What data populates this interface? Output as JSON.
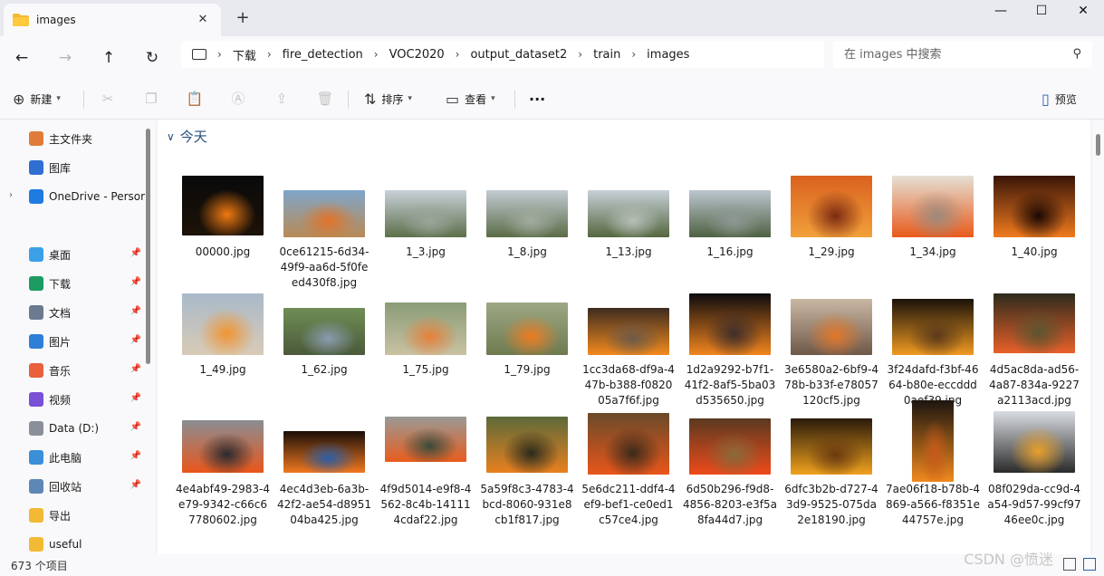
{
  "tab": {
    "title": "images",
    "close": "✕",
    "new_tab": "+"
  },
  "window": {
    "minimize": "—",
    "maximize": "☐",
    "close": "✕"
  },
  "nav": {
    "back": "←",
    "forward": "→",
    "up": "↑",
    "refresh": "↻"
  },
  "breadcrumb": [
    "下载",
    "fire_detection",
    "VOC2020",
    "output_dataset2",
    "train",
    "images"
  ],
  "search": {
    "placeholder": "在 images 中搜索"
  },
  "commands": {
    "new": "新建",
    "sort": "排序",
    "view": "查看",
    "more": "···",
    "preview": "预览"
  },
  "sidebar": {
    "items": [
      {
        "label": "主文件夹",
        "icon": "home-icon",
        "color": "#e07b39"
      },
      {
        "label": "图库",
        "icon": "gallery-icon",
        "color": "#2f6fd1"
      },
      {
        "label": "OneDrive - Persor",
        "icon": "onedrive-icon",
        "color": "#1e7be0"
      },
      {
        "label": "桌面",
        "icon": "desktop-icon",
        "color": "#3aa0e8",
        "pinned": true
      },
      {
        "label": "下载",
        "icon": "download-icon",
        "color": "#1b9b62",
        "pinned": true
      },
      {
        "label": "文档",
        "icon": "document-icon",
        "color": "#6b7a8f",
        "pinned": true
      },
      {
        "label": "图片",
        "icon": "pictures-icon",
        "color": "#2f7fd8",
        "pinned": true
      },
      {
        "label": "音乐",
        "icon": "music-icon",
        "color": "#e8603c",
        "pinned": true
      },
      {
        "label": "视频",
        "icon": "video-icon",
        "color": "#7b4fd6",
        "pinned": true
      },
      {
        "label": "Data (D:)",
        "icon": "drive-icon",
        "color": "#8a8f99",
        "pinned": true
      },
      {
        "label": "此电脑",
        "icon": "this-pc-icon",
        "color": "#3a8fd8",
        "pinned": true
      },
      {
        "label": "回收站",
        "icon": "recycle-bin-icon",
        "color": "#5d88b5",
        "pinned": true
      },
      {
        "label": "导出",
        "icon": "folder-icon",
        "color": "#f2b935"
      },
      {
        "label": "useful",
        "icon": "folder-icon",
        "color": "#f2b935"
      }
    ],
    "pin_glyph": "📌"
  },
  "group": {
    "label": "今天",
    "chevron": "∨"
  },
  "files": [
    {
      "name": "00000.jpg",
      "colors": [
        "#0a0a0a",
        "#1c1208",
        "#f07a12"
      ]
    },
    {
      "name": "0ce61215-6d34-49f9-aa6d-5f0feed430f8.jpg",
      "colors": [
        "#7fa6c9",
        "#b88a55",
        "#e2732a"
      ]
    },
    {
      "name": "1_3.jpg",
      "colors": [
        "#c9d1d9",
        "#5d6f4a",
        "#9aa59b"
      ]
    },
    {
      "name": "1_8.jpg",
      "colors": [
        "#c3ccd4",
        "#5b6c47",
        "#a3ab9f"
      ]
    },
    {
      "name": "1_13.jpg",
      "colors": [
        "#c8d0d8",
        "#55673f",
        "#b7bfb8"
      ]
    },
    {
      "name": "1_16.jpg",
      "colors": [
        "#bcc6cf",
        "#4e6142",
        "#8d9893"
      ]
    },
    {
      "name": "1_29.jpg",
      "colors": [
        "#d9621e",
        "#f2a03a",
        "#7b2a12"
      ]
    },
    {
      "name": "1_34.jpg",
      "colors": [
        "#e6e0d5",
        "#e85a1a",
        "#9c8a7c"
      ]
    },
    {
      "name": "1_40.jpg",
      "colors": [
        "#3a1508",
        "#f07b1e",
        "#1a0804"
      ]
    },
    {
      "name": "1_49.jpg",
      "colors": [
        "#a9b9c9",
        "#d8cbb6",
        "#f19533"
      ]
    },
    {
      "name": "1_62.jpg",
      "colors": [
        "#6f8e55",
        "#4b5a3a",
        "#8a9bb0"
      ]
    },
    {
      "name": "1_75.jpg",
      "colors": [
        "#8a9c77",
        "#c9c2a3",
        "#e6803a"
      ]
    },
    {
      "name": "1_79.jpg",
      "colors": [
        "#9da885",
        "#6f7a4f",
        "#ed7c22"
      ]
    },
    {
      "name": "1cc3da68-df9a-447b-b388-f082005a7f6f.jpg",
      "colors": [
        "#3d2c20",
        "#f28a1e",
        "#6d5a4a"
      ]
    },
    {
      "name": "1d2a9292-b7f1-41f2-8af5-5ba03d535650.jpg",
      "colors": [
        "#0d0b0e",
        "#f2851e",
        "#3d2d2a"
      ]
    },
    {
      "name": "3e6580a2-6bf9-478b-b33f-e78057120cf5.jpg",
      "colors": [
        "#c9b8a3",
        "#6e5848",
        "#e2772a"
      ]
    },
    {
      "name": "3f24dafd-f3bf-4664-b80e-eccddd0aef39.jpg",
      "colors": [
        "#1a120a",
        "#f09a22",
        "#5b3a1a"
      ]
    },
    {
      "name": "4d5ac8da-ad56-4a87-834a-9227a2113acd.jpg",
      "colors": [
        "#2d2a1c",
        "#e8602a",
        "#5b5530"
      ]
    },
    {
      "name": "4e4abf49-2983-4e79-9342-c66c67780602.jpg",
      "colors": [
        "#8a8d93",
        "#e9561a",
        "#2a2a2e"
      ]
    },
    {
      "name": "4ec4d3eb-6a3b-42f2-ae54-d895104ba425.jpg",
      "colors": [
        "#1a0e08",
        "#f07820",
        "#2b5fa8"
      ]
    },
    {
      "name": "4f9d5014-e9f8-4562-8c4b-141114cdaf22.jpg",
      "colors": [
        "#9a9a96",
        "#e85c1c",
        "#3a4a3a"
      ]
    },
    {
      "name": "5a59f8c3-4783-4bcd-8060-931e8cb1f817.jpg",
      "colors": [
        "#5d6a3a",
        "#e8801e",
        "#2a2a1c"
      ]
    },
    {
      "name": "5e6dc211-ddf4-4ef9-bef1-ce0ed1c57ce4.jpg",
      "colors": [
        "#6a4a2a",
        "#e8561a",
        "#3a2a1a"
      ]
    },
    {
      "name": "6d50b296-f9d8-4856-8203-e3f5a8fa44d7.jpg",
      "colors": [
        "#5a3a20",
        "#ee4a1a",
        "#8a6a3a"
      ]
    },
    {
      "name": "6dfc3b2b-d727-43d9-9525-075da2e18190.jpg",
      "colors": [
        "#2a1a0a",
        "#f0a21e",
        "#6a3a10"
      ]
    },
    {
      "name": "7ae06f18-b78b-4869-a566-f8351e44757e.jpg",
      "colors": [
        "#1c1510",
        "#f08a1e",
        "#c85a1a"
      ]
    },
    {
      "name": "08f029da-cc9d-4a54-9d57-99cf9746ee0c.jpg",
      "colors": [
        "#d9dde3",
        "#2a2a2a",
        "#e8a02a"
      ]
    }
  ],
  "status": {
    "count": "673 个项目"
  },
  "watermark": "CSDN @愤迷"
}
